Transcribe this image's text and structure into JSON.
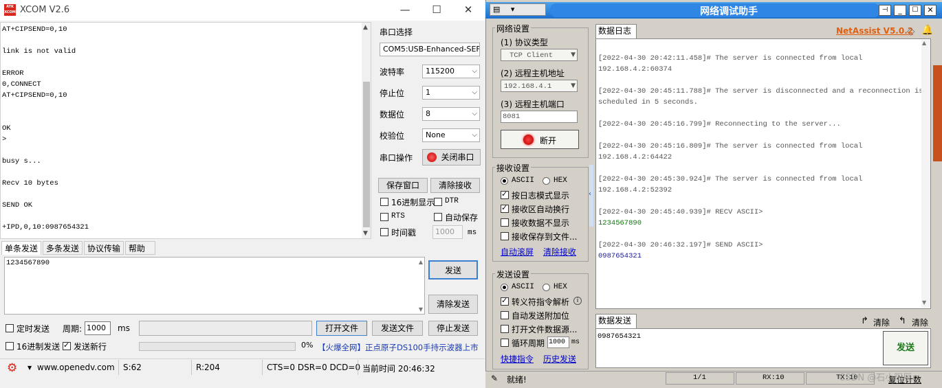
{
  "xcom": {
    "title": "XCOM V2.6",
    "logo_text": "ATK XCOM",
    "recv_lines": [
      {
        "text": "AT+CIPSEND=0,10",
        "line": 0
      },
      {
        "text": "link is not valid",
        "line": 2
      },
      {
        "text": "ERROR",
        "line": 4
      },
      {
        "text": "0,CONNECT",
        "line": 5
      },
      {
        "text": "AT+CIPSEND=0,10",
        "line": 6
      },
      {
        "text": "OK",
        "line": 9
      },
      {
        "text": ">",
        "line": 10
      },
      {
        "text": "busy s...",
        "line": 12
      },
      {
        "text": "Recv 10 bytes",
        "line": 14
      },
      {
        "text": "SEND OK",
        "line": 16
      },
      {
        "text": "+IPD,0,10:0987654321",
        "line": 18
      }
    ],
    "settings": {
      "port_label": "串口选择",
      "port_value": "COM5:USB-Enhanced-SEF",
      "baud_label": "波特率",
      "baud_value": "115200",
      "stop_label": "停止位",
      "stop_value": "1",
      "data_label": "数据位",
      "data_value": "8",
      "parity_label": "校验位",
      "parity_value": "None",
      "op_label": "串口操作",
      "close_port": "关闭串口",
      "save_window": "保存窗口",
      "clear_recv": "清除接收",
      "hex_display": "16进制显示",
      "dtr": "DTR",
      "rts": "RTS",
      "auto_save": "自动保存",
      "timestamp": "时间戳",
      "timestamp_ms": "1000",
      "ms": "ms"
    },
    "tabs": [
      "单条发送",
      "多条发送",
      "协议传输",
      "帮助"
    ],
    "send_text": "1234567890",
    "send_btn": "发送",
    "clear_send": "清除发送",
    "timed_send": "定时发送",
    "period_label": "周期:",
    "period_value": "1000",
    "period_unit": "ms",
    "open_file": "打开文件",
    "send_file": "发送文件",
    "stop_send": "停止发送",
    "hex_send": "16进制发送",
    "send_newline": "发送新行",
    "progress_pct": "0%",
    "ad_text": "【火爆全网】正点原子DS100手持示波器上市",
    "status": {
      "url": "www.openedv.com",
      "s": "S:62",
      "r": "R:204",
      "lines": "CTS=0 DSR=0 DCD=0",
      "time": "当前时间 20:46:32"
    }
  },
  "net": {
    "title": "网络调试助手",
    "net_settings": "网络设置",
    "proto_label": "(1) 协议类型",
    "proto_value": "TCP Client",
    "host_label": "(2) 远程主机地址",
    "host_value": "192.168.4.1",
    "port_label": "(3) 远程主机端口",
    "port_value": "8081",
    "disconnect": "断开",
    "recv_settings": "接收设置",
    "ascii": "ASCII",
    "hex": "HEX",
    "log_mode": "按日志模式显示",
    "auto_wrap": "接收区自动换行",
    "no_display": "接收数据不显示",
    "save_to_file": "接收保存到文件...",
    "auto_scroll": "自动滚屏",
    "clear_recv": "清除接收",
    "send_settings": "发送设置",
    "escape": "转义符指令解析",
    "auto_append": "自动发送附加位",
    "open_file_src": "打开文件数据源...",
    "loop_period": "循环周期",
    "loop_value": "1000",
    "loop_unit": "ms",
    "shortcut": "快捷指令",
    "history": "历史发送",
    "log_tab": "数据日志",
    "brand": "NetAssist V5.0.2",
    "log": [
      {
        "text": "[2022-04-30 20:42:11.458]# The server is connected from local",
        "color": "#555555"
      },
      {
        "text": "192.168.4.2:60374",
        "color": "#555555"
      },
      {
        "text": "",
        "color": "#555555"
      },
      {
        "text": "[2022-04-30 20:45:11.788]# The server is disconnected and a reconnection is",
        "color": "#555555"
      },
      {
        "text": "scheduled in 5 seconds.",
        "color": "#555555"
      },
      {
        "text": "",
        "color": "#555555"
      },
      {
        "text": "[2022-04-30 20:45:16.799]# Reconnecting to the server...",
        "color": "#555555"
      },
      {
        "text": "",
        "color": "#555555"
      },
      {
        "text": "[2022-04-30 20:45:16.809]# The server is connected from local",
        "color": "#555555"
      },
      {
        "text": "192.168.4.2:64422",
        "color": "#555555"
      },
      {
        "text": "",
        "color": "#555555"
      },
      {
        "text": "[2022-04-30 20:45:30.924]# The server is connected from local",
        "color": "#555555"
      },
      {
        "text": "192.168.4.2:52392",
        "color": "#555555"
      },
      {
        "text": "",
        "color": "#555555"
      },
      {
        "text": "[2022-04-30 20:45:40.939]# RECV ASCII>",
        "color": "#555555"
      },
      {
        "text": "1234567890",
        "color": "#0a7a0a"
      },
      {
        "text": "",
        "color": "#555555"
      },
      {
        "text": "[2022-04-30 20:46:32.197]# SEND ASCII>",
        "color": "#555555"
      },
      {
        "text": "0987654321",
        "color": "#1a1a9a"
      }
    ],
    "send_tab": "数据发送",
    "clear1": "清除",
    "clear2": "清除",
    "send_text": "0987654321",
    "send_btn": "发送",
    "status": {
      "ready": "就绪!",
      "page": "1/1",
      "rx": "RX:10",
      "tx": "TX:10",
      "reset": "复位计数"
    },
    "watermark": "CSDN @石小阳辰"
  },
  "colors": {
    "brand": "#e06010",
    "send_green": "#1a7a1a",
    "red_led": "#e01010"
  }
}
